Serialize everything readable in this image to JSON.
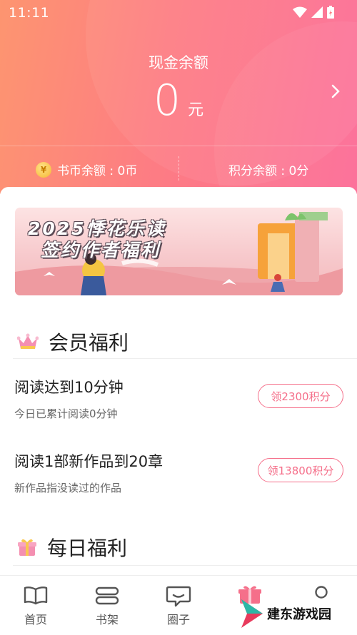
{
  "status_bar": {
    "time": "11:11"
  },
  "wallet": {
    "cash_label": "现金余额",
    "cash_amount": "0",
    "cash_unit": "元",
    "coin_balance": "书币余额 : 0币",
    "points_balance": "积分余额 : 0分"
  },
  "banner": {
    "line1": "2025悸花乐读",
    "line2": "签约作者福利"
  },
  "member_benefits": {
    "title": "会员福利",
    "tasks": [
      {
        "title": "阅读达到10分钟",
        "subtitle": "今日已累计阅读0分钟",
        "button": "领2300积分"
      },
      {
        "title": "阅读1部新作品到20章",
        "subtitle": "新作品指没读过的作品",
        "button": "领13800积分"
      }
    ]
  },
  "daily_benefits": {
    "title": "每日福利"
  },
  "tab_bar": {
    "items": [
      {
        "label": "首页",
        "icon": "book-open-icon"
      },
      {
        "label": "书架",
        "icon": "bookshelf-icon"
      },
      {
        "label": "圈子",
        "icon": "chat-bubble-icon"
      },
      {
        "label": "",
        "icon": "gift-icon",
        "active_color": "#f56f8a"
      },
      {
        "label": "",
        "icon": "profile-icon"
      }
    ]
  },
  "watermark": {
    "text": "建东游戏园"
  },
  "colors": {
    "accent": "#f56f8a",
    "header_start": "#fd9570",
    "header_end": "#fc6b96"
  }
}
